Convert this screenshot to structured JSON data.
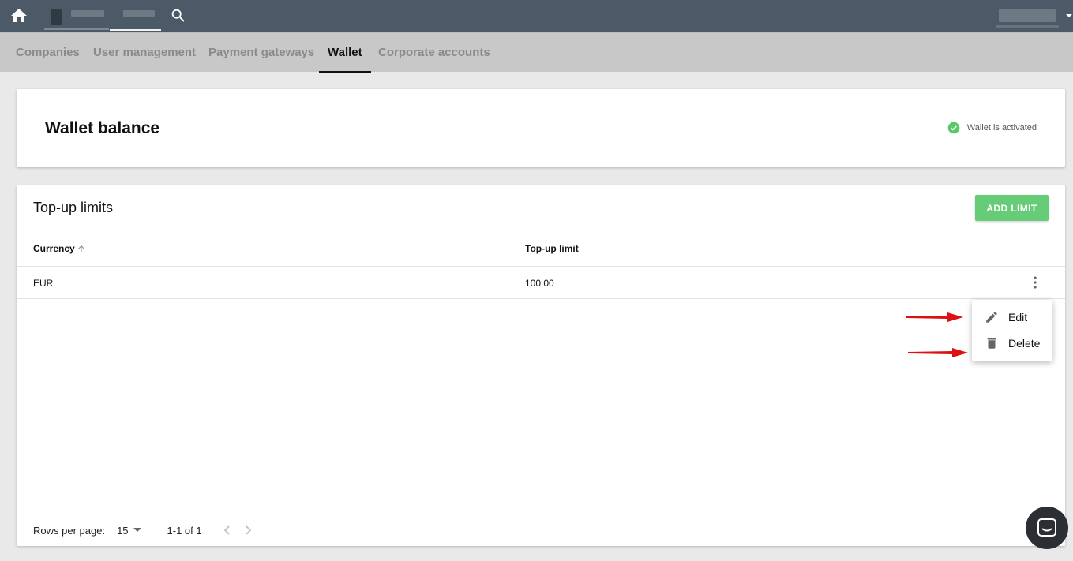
{
  "tabs": [
    {
      "label": "Companies"
    },
    {
      "label": "User management"
    },
    {
      "label": "Payment gateways"
    },
    {
      "label": "Wallet"
    },
    {
      "label": "Corporate accounts"
    }
  ],
  "active_tab": "Wallet",
  "wallet_card": {
    "title": "Wallet balance",
    "status": "Wallet is activated",
    "status_color": "#5cc76a"
  },
  "limits_card": {
    "title": "Top-up limits",
    "add_button": "ADD LIMIT",
    "columns": [
      "Currency",
      "Top-up limit"
    ],
    "rows": [
      {
        "currency": "EUR",
        "limit": "100.00"
      }
    ]
  },
  "pagination": {
    "rows_per_page_label": "Rows per page:",
    "rows_per_page_value": "15",
    "range": "1-1 of 1"
  },
  "row_menu": {
    "edit": "Edit",
    "delete": "Delete"
  },
  "colors": {
    "topbar": "#4b5a66",
    "accent_green": "#66cc77",
    "annotation_arrow": "#dd1111"
  }
}
